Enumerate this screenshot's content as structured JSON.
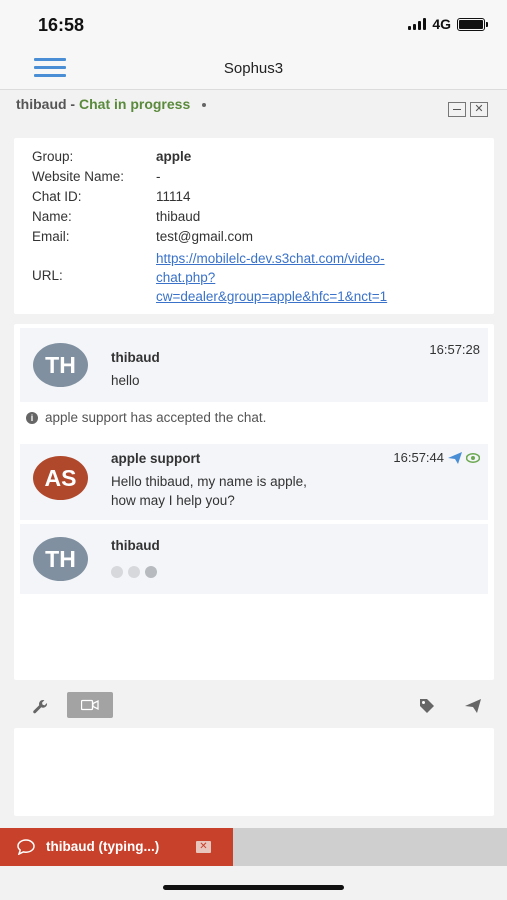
{
  "status_bar": {
    "time": "16:58",
    "network": "4G"
  },
  "header": {
    "title": "Sophus3"
  },
  "chat": {
    "user": "thibaud",
    "separator": " - ",
    "status": "Chat in progress",
    "close_symbol": "✕"
  },
  "info": {
    "labels": {
      "group": "Group:",
      "website": "Website Name:",
      "chat_id": "Chat ID:",
      "name": "Name:",
      "email": "Email:",
      "url": "URL:"
    },
    "group": "apple",
    "website": "-",
    "chat_id": "11114",
    "name": "thibaud",
    "email": "test@gmail.com",
    "url_lines": [
      "https://mobilelc-dev.s3chat.com/video-",
      "chat.php?",
      "cw=dealer&group=apple&hfc=1&nct=1"
    ]
  },
  "messages": [
    {
      "initials": "TH",
      "author": "thibaud",
      "time": "16:57:28",
      "text": "hello"
    },
    {
      "initials": "AS",
      "author": "apple support",
      "time": "16:57:44",
      "text_lines": [
        "Hello thibaud, my name is apple,",
        "how may I help you?"
      ]
    },
    {
      "initials": "TH",
      "author": "thibaud"
    }
  ],
  "system_note": "apple support has accepted the chat.",
  "system_icon_glyph": "i",
  "typing_tab": {
    "label": "thibaud (typing...)",
    "close_symbol": "✕"
  },
  "colors": {
    "accent": "#4a8fd6",
    "status_green": "#5a8a3c",
    "typing_tab": "#c8412a",
    "avatar_agent": "#b0482c",
    "avatar_user": "#8090a0"
  }
}
